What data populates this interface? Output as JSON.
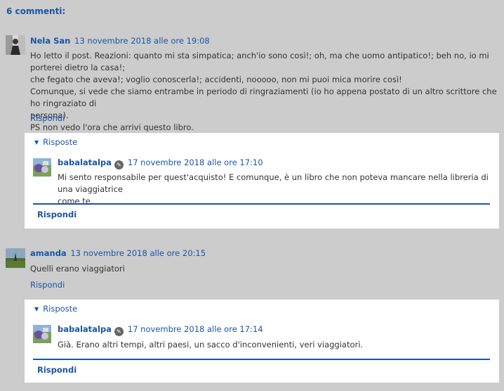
{
  "comments_title": "6 commenti:",
  "comments": [
    {
      "author": "Nela San",
      "date": "13 novembre 2018 alle ore 19:08",
      "lines": [
        "Ho letto il post. Reazioni: quanto mi sta simpatica; anch'io sono così!; oh, ma che uomo antipatico!; beh no, io mi porterei dietro la casa!;",
        "che fegato che aveva!; voglio conoscerla!; accidenti, nooooo, non mi puoi mica morire così!",
        "Comunque, si vede che siamo entrambe in periodo di ringraziamenti (io ho appena postato di un altro scrittore che ho ringraziato di",
        "persona).",
        "PS non vedo l'ora che arrivi questo libro."
      ],
      "reply_label": "Rispondi",
      "thread": {
        "toggle_label": "Risposte",
        "reply": {
          "author": "babalatalpa",
          "date": "17 novembre 2018 alle ore 17:10",
          "lines": [
            "Mi sento responsabile per quest'acquisto! E comunque, è un libro che non poteva mancare nella libreria di una viaggiatrice",
            "come te."
          ]
        },
        "reply_button": "Rispondi"
      }
    },
    {
      "author": "amanda",
      "date": "13 novembre 2018 alle ore 20:15",
      "lines": [
        "Quelli erano viaggiatori"
      ],
      "reply_label": "Rispondi",
      "thread": {
        "toggle_label": "Risposte",
        "reply": {
          "author": "babalatalpa",
          "date": "17 novembre 2018 alle ore 17:14",
          "lines": [
            "Già. Erano altri tempi, altri paesi, un sacco d'inconvenienti, veri viaggiatori."
          ]
        },
        "reply_button": "Rispondi"
      }
    }
  ],
  "icons": {
    "thread_toggle": "triangle-down-icon",
    "edit": "pencil-icon"
  },
  "colors": {
    "background": "#cccccc",
    "link": "#1a55a7",
    "thread_bg": "#ffffff",
    "text": "#333333"
  }
}
